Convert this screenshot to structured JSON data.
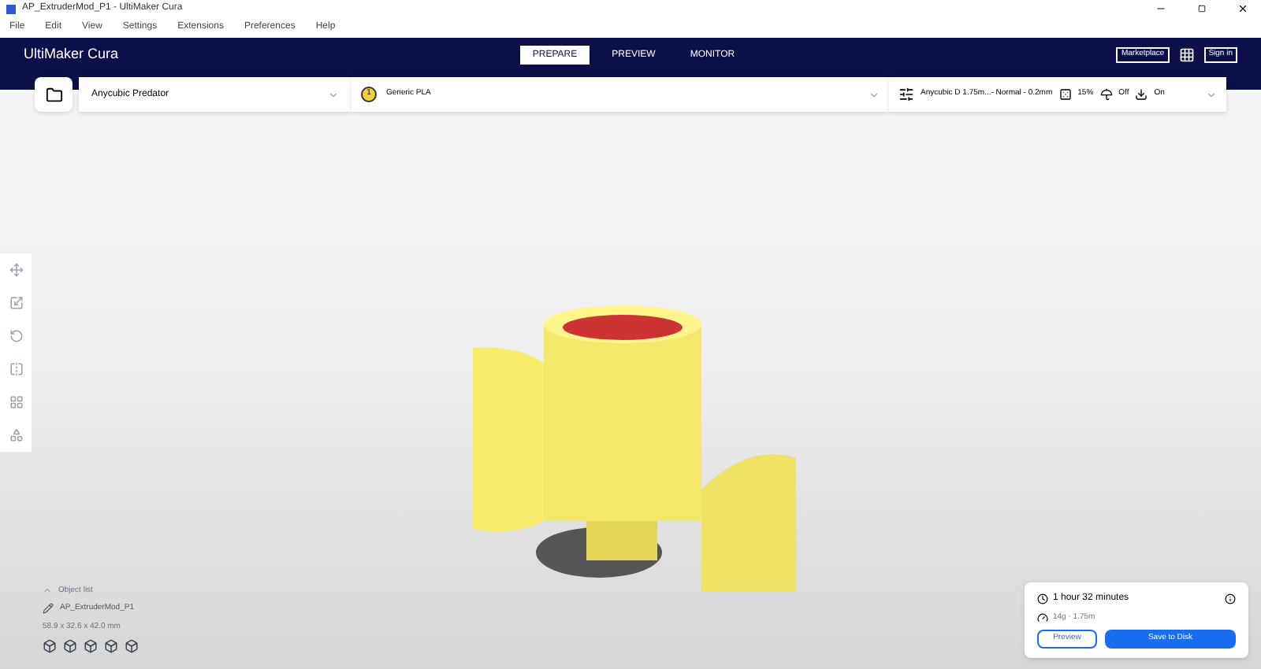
{
  "window": {
    "title": "AP_ExtruderMod_P1 - UltiMaker Cura"
  },
  "menu": [
    "File",
    "Edit",
    "View",
    "Settings",
    "Extensions",
    "Preferences",
    "Help"
  ],
  "header": {
    "logo": "UltiMaker Cura",
    "stages": [
      {
        "label": "PREPARE",
        "selected": true
      },
      {
        "label": "PREVIEW",
        "selected": false
      },
      {
        "label": "MONITOR",
        "selected": false
      }
    ],
    "marketplace": "Marketplace",
    "sign_in": "Sign in"
  },
  "toolbar": {
    "printer": "Anycubic Predator",
    "extruder": "1",
    "material": "Generic PLA",
    "profile": "Anycubic D 1.75m...- Normal - 0.2mm",
    "infill": "15%",
    "support": "Off",
    "adhesion": "On"
  },
  "object_list": {
    "header": "Object list",
    "name": "AP_ExtruderMod_P1",
    "dimensions": "58.9 x 32.6 x 42.0 mm"
  },
  "print_panel": {
    "time": "1 hour 32 minutes",
    "material": "14g · 1.75m",
    "buttons": [
      {
        "label": "Preview",
        "kind": "secondary"
      },
      {
        "label": "Save to Disk",
        "kind": "primary"
      }
    ]
  }
}
